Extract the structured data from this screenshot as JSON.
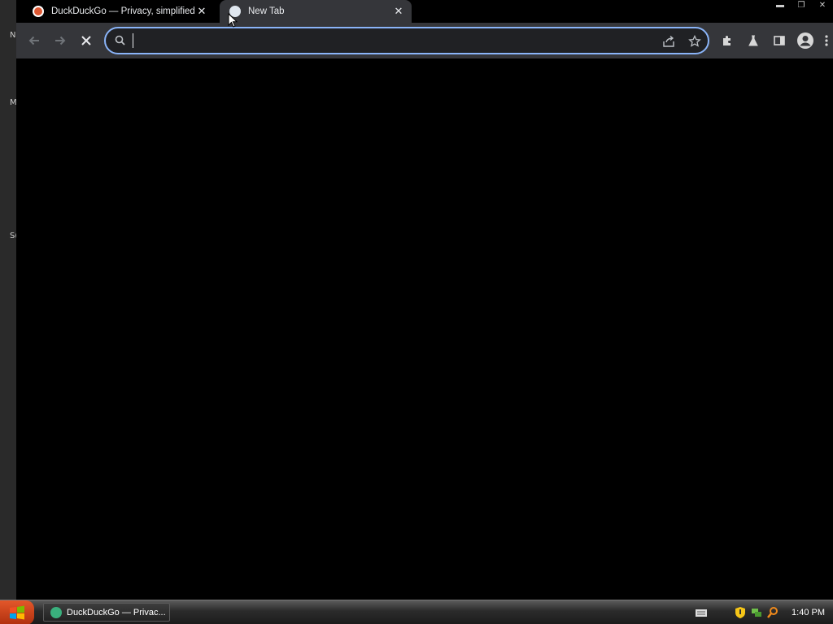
{
  "browser": {
    "tabs": [
      {
        "title": "DuckDuckGo — Privacy, simplified.",
        "active": false,
        "favicon": "duckduckgo-icon"
      },
      {
        "title": "New Tab",
        "active": true,
        "favicon": "new-tab-icon"
      }
    ],
    "omnibox": {
      "value": "",
      "placeholder": ""
    }
  },
  "desktop": {
    "fragments": [
      "N",
      "M",
      "S("
    ]
  },
  "taskbar": {
    "window_label": "DuckDuckGo — Privac...",
    "clock": "1:40 PM"
  },
  "colors": {
    "toolbar_bg": "#35363a",
    "omnibox_border": "#8ab4f8",
    "content_bg": "#000000"
  }
}
